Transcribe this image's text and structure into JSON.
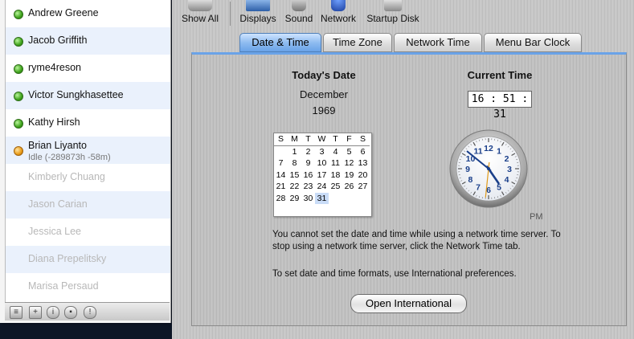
{
  "buddies": [
    {
      "name": "Andrew Greene",
      "status": "online"
    },
    {
      "name": "Jacob Griffith",
      "status": "online"
    },
    {
      "name": "ryme4reson",
      "status": "online"
    },
    {
      "name": "Victor Sungkhasettee",
      "status": "online"
    },
    {
      "name": "Kathy Hirsh",
      "status": "online"
    },
    {
      "name": "Brian Liyanto",
      "status": "idle",
      "sub": "Idle (-289873h -58m)"
    },
    {
      "name": "Kimberly Chuang",
      "status": "offline"
    },
    {
      "name": "Jason Carian",
      "status": "offline"
    },
    {
      "name": "Jessica Lee",
      "status": "offline"
    },
    {
      "name": "Diana Prepelitsky",
      "status": "offline"
    },
    {
      "name": "Marisa Persaud",
      "status": "offline"
    }
  ],
  "buddy_toolbar": {
    "menu": "≡",
    "add": "+",
    "info": "i",
    "block": "▪",
    "warn": "!"
  },
  "toolbar": {
    "show_all": "Show All",
    "displays": "Displays",
    "sound": "Sound",
    "network": "Network",
    "startup_disk": "Startup Disk"
  },
  "tabs": {
    "date_time": "Date & Time",
    "time_zone": "Time Zone",
    "network_time": "Network Time",
    "menu_bar_clock": "Menu Bar Clock"
  },
  "today": {
    "heading": "Today's Date",
    "month": "December",
    "year": "1969"
  },
  "calendar": {
    "weekdays": [
      "S",
      "M",
      "T",
      "W",
      "T",
      "F",
      "S"
    ],
    "weeks": [
      [
        "",
        "1",
        "2",
        "3",
        "4",
        "5",
        "6"
      ],
      [
        "7",
        "8",
        "9",
        "10",
        "11",
        "12",
        "13"
      ],
      [
        "14",
        "15",
        "16",
        "17",
        "18",
        "19",
        "20"
      ],
      [
        "21",
        "22",
        "23",
        "24",
        "25",
        "26",
        "27"
      ],
      [
        "28",
        "29",
        "30",
        "31",
        "",
        "",
        ""
      ]
    ],
    "today": "31"
  },
  "current_time": {
    "heading": "Current Time",
    "value": "16 : 51 : 31",
    "ampm": "PM"
  },
  "clock": {
    "hour": 16,
    "minute": 51,
    "second": 31
  },
  "messages": {
    "network_note": "You cannot set the date and time while using a network time server. To stop using a network time server, click the Network Time tab.",
    "formats_note": "To set date and time formats, use International preferences."
  },
  "open_international": "Open International",
  "colors": {
    "tab_selected": "#6aa3e8",
    "online": "#3ea21b",
    "idle": "#e99b16",
    "second_hand": "#e09a1a",
    "clock_hand": "#1a3f8a"
  }
}
